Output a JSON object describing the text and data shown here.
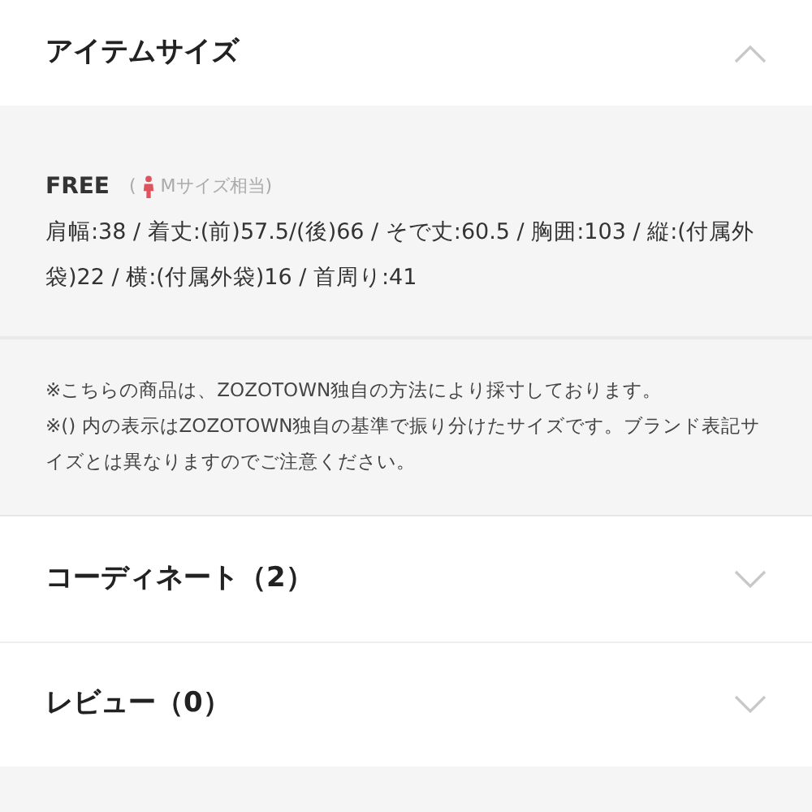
{
  "item_size": {
    "title": "アイテムサイズ",
    "expanded": true,
    "size_name": "FREE",
    "equiv_open": "(",
    "equiv_label": "Mサイズ相当)",
    "measurements": "肩幅:38 / 着丈:(前)57.5/(後)66 / そで丈:60.5 / 胸囲:103 / 縦:(付属外袋)22 / 横:(付属外袋)16 / 首周り:41",
    "notes": [
      "※こちらの商品は、ZOZOTOWN独自の方法により採寸しております。",
      "※() 内の表示はZOZOTOWN独自の基準で振り分けたサイズです。ブランド表記サイズとは異なりますのでご注意ください。"
    ]
  },
  "sections": [
    {
      "title": "コーディネート（2）",
      "expanded": false
    },
    {
      "title": "レビュー（0）",
      "expanded": false
    }
  ]
}
